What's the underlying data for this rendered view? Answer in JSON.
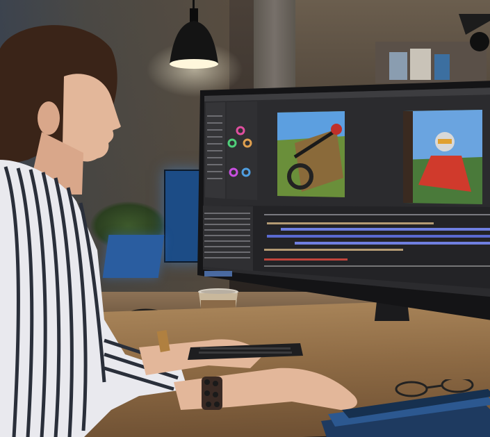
{
  "scene": {
    "description_free": true,
    "colors": {
      "wall": "#4a4038",
      "desk": "#a78358",
      "monitor_frame": "#1a1a1c",
      "screen_bg": "#2b2b2e",
      "timeline_blue": "#6f7fe0",
      "timeline_tan": "#b49b74",
      "timeline_red": "#c0453c",
      "shirt_stripe": "#2a2f3a",
      "skin": "#e3b79a",
      "hair": "#3a2418"
    },
    "icons": [
      "pendant-lamp-icon",
      "coffee-cup-icon",
      "headphones-icon",
      "keyboard-icon",
      "mouse-icon",
      "eyeglasses-icon"
    ]
  }
}
